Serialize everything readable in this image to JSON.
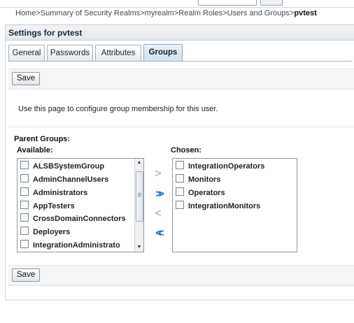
{
  "breadcrumb": {
    "items": [
      "Home",
      "Summary of Security Realms",
      "myrealm",
      "Realm Roles",
      "Users and Groups"
    ],
    "separator": ">",
    "current": "pvtest"
  },
  "panel": {
    "title": "Settings for pvtest"
  },
  "tabs": [
    {
      "label": "General",
      "active": false
    },
    {
      "label": "Passwords",
      "active": false
    },
    {
      "label": "Attributes",
      "active": false
    },
    {
      "label": "Groups",
      "active": true
    }
  ],
  "buttons": {
    "save_top": "Save",
    "save_bottom": "Save"
  },
  "description": "Use this page to configure group membership for this user.",
  "groups": {
    "heading": "Parent Groups:",
    "available_label": "Available:",
    "chosen_label": "Chosen:",
    "available": [
      "ALSBSystemGroup",
      "AdminChannelUsers",
      "Administrators",
      "AppTesters",
      "CrossDomainConnectors",
      "Deployers",
      "IntegrationAdministrato"
    ],
    "chosen": [
      "IntegrationOperators",
      "Monitors",
      "Operators",
      "IntegrationMonitors"
    ]
  },
  "shuttle": {
    "move_one": ">",
    "move_all": ">>",
    "remove_one": "<",
    "remove_all": "<<"
  },
  "icons": {
    "move": "chevron-right-icon",
    "move_all": "double-chevron-right-icon",
    "remove": "chevron-left-icon",
    "remove_all": "double-chevron-left-icon",
    "scroll_up": "arrow-up-icon",
    "scroll_down": "arrow-down-icon"
  },
  "colors": {
    "accent": "#2b6cc4",
    "disabled": "#9aa3ab",
    "panel_border": "#c6ccd2"
  }
}
